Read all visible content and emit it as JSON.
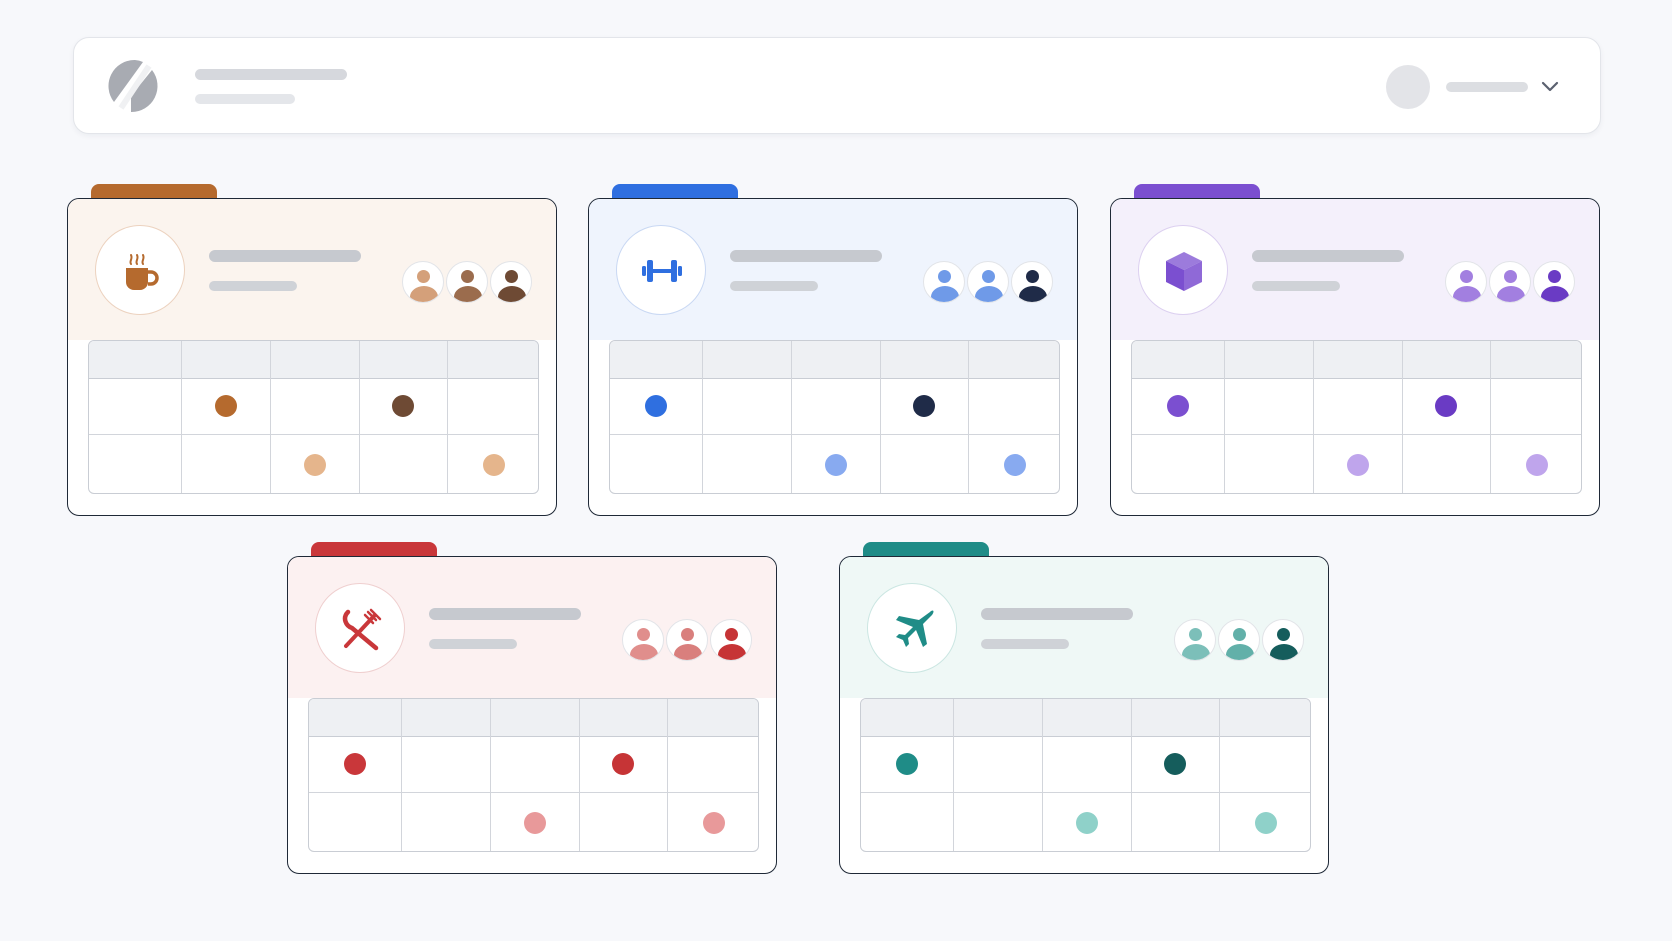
{
  "header": {
    "logo_icon": "slash-logo-icon",
    "user_menu_icon": "chevron-down-icon"
  },
  "groups": [
    {
      "id": "coffee",
      "icon": "coffee-mug-icon",
      "accent": "#b56a2e",
      "accent_light": "#e5b58c",
      "head_bg": "#fbf4ee",
      "badge_border": "#ecd2bf",
      "members": [
        "#d4a07a",
        "#9b6c4d",
        "#6e4a34"
      ],
      "rows": [
        [
          false,
          "dark",
          false,
          "darker",
          false
        ],
        [
          false,
          false,
          "light",
          false,
          "light"
        ]
      ]
    },
    {
      "id": "fitness",
      "icon": "dumbbell-icon",
      "accent": "#2f6fe0",
      "accent_light": "#88aaf0",
      "head_bg": "#eff4fd",
      "badge_border": "#c9d8f3",
      "members": [
        "#6f9ae8",
        "#6f9ae8",
        "#1f2b48"
      ],
      "rows": [
        [
          "dark",
          false,
          false,
          "darker",
          false
        ],
        [
          false,
          false,
          "light",
          false,
          "light"
        ]
      ]
    },
    {
      "id": "gaming",
      "icon": "cube-icon",
      "accent": "#7b4fd0",
      "accent_light": "#bfa5ec",
      "head_bg": "#f4f0fb",
      "badge_border": "#dcd0f0",
      "members": [
        "#a27fe0",
        "#a27fe0",
        "#6a3bc4"
      ],
      "rows": [
        [
          "dark",
          false,
          false,
          "darker",
          false
        ],
        [
          false,
          false,
          "light",
          false,
          "light"
        ]
      ]
    },
    {
      "id": "dining",
      "icon": "fork-knife-icon",
      "accent": "#c9373a",
      "accent_light": "#e8999a",
      "head_bg": "#fcf1f1",
      "badge_border": "#efcfcf",
      "members": [
        "#e08e8c",
        "#d97f7d",
        "#c63436"
      ],
      "rows": [
        [
          "dark",
          false,
          false,
          "darker",
          false
        ],
        [
          false,
          false,
          "light",
          false,
          "light"
        ]
      ]
    },
    {
      "id": "travel",
      "icon": "airplane-icon",
      "accent": "#1f8c87",
      "accent_light": "#8fd1c9",
      "head_bg": "#eff8f6",
      "badge_border": "#cbe6e2",
      "members": [
        "#7cbfb9",
        "#62b0a9",
        "#155d5c"
      ],
      "rows": [
        [
          "dark",
          false,
          false,
          "darker",
          false
        ],
        [
          false,
          false,
          "light",
          false,
          "light"
        ]
      ]
    }
  ]
}
